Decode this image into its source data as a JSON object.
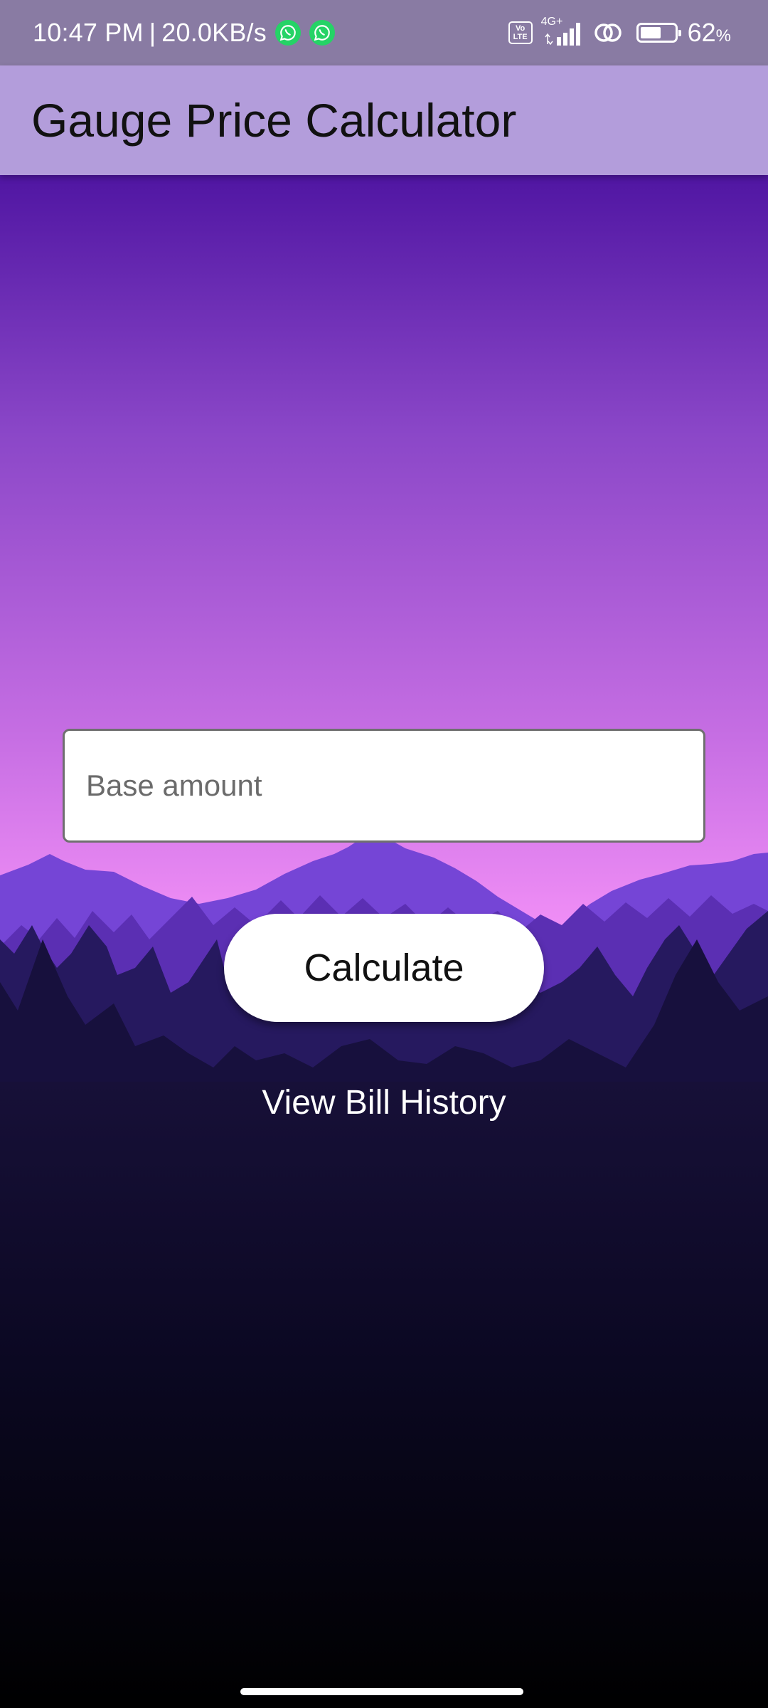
{
  "status_bar": {
    "time": "10:47 PM",
    "separator": "|",
    "network_speed": "20.0KB/s",
    "notification_icons": [
      "whatsapp-icon",
      "whatsapp-icon"
    ],
    "volte_label": "Vo LTE",
    "network_type": "4G+",
    "battery_level": 0.62,
    "battery_percent": "62",
    "battery_unit": "%"
  },
  "app_bar": {
    "title": "Gauge Price Calculator"
  },
  "form": {
    "base_amount_value": "",
    "base_amount_placeholder": "Base amount",
    "calculate_label": "Calculate",
    "history_link_label": "View Bill History"
  },
  "colors": {
    "status_bar": "#897ba3",
    "app_bar": "#b39ddb",
    "sky_top": "#5116a3",
    "sky_bottom": "#ee8ef5",
    "ground": "#000000"
  }
}
